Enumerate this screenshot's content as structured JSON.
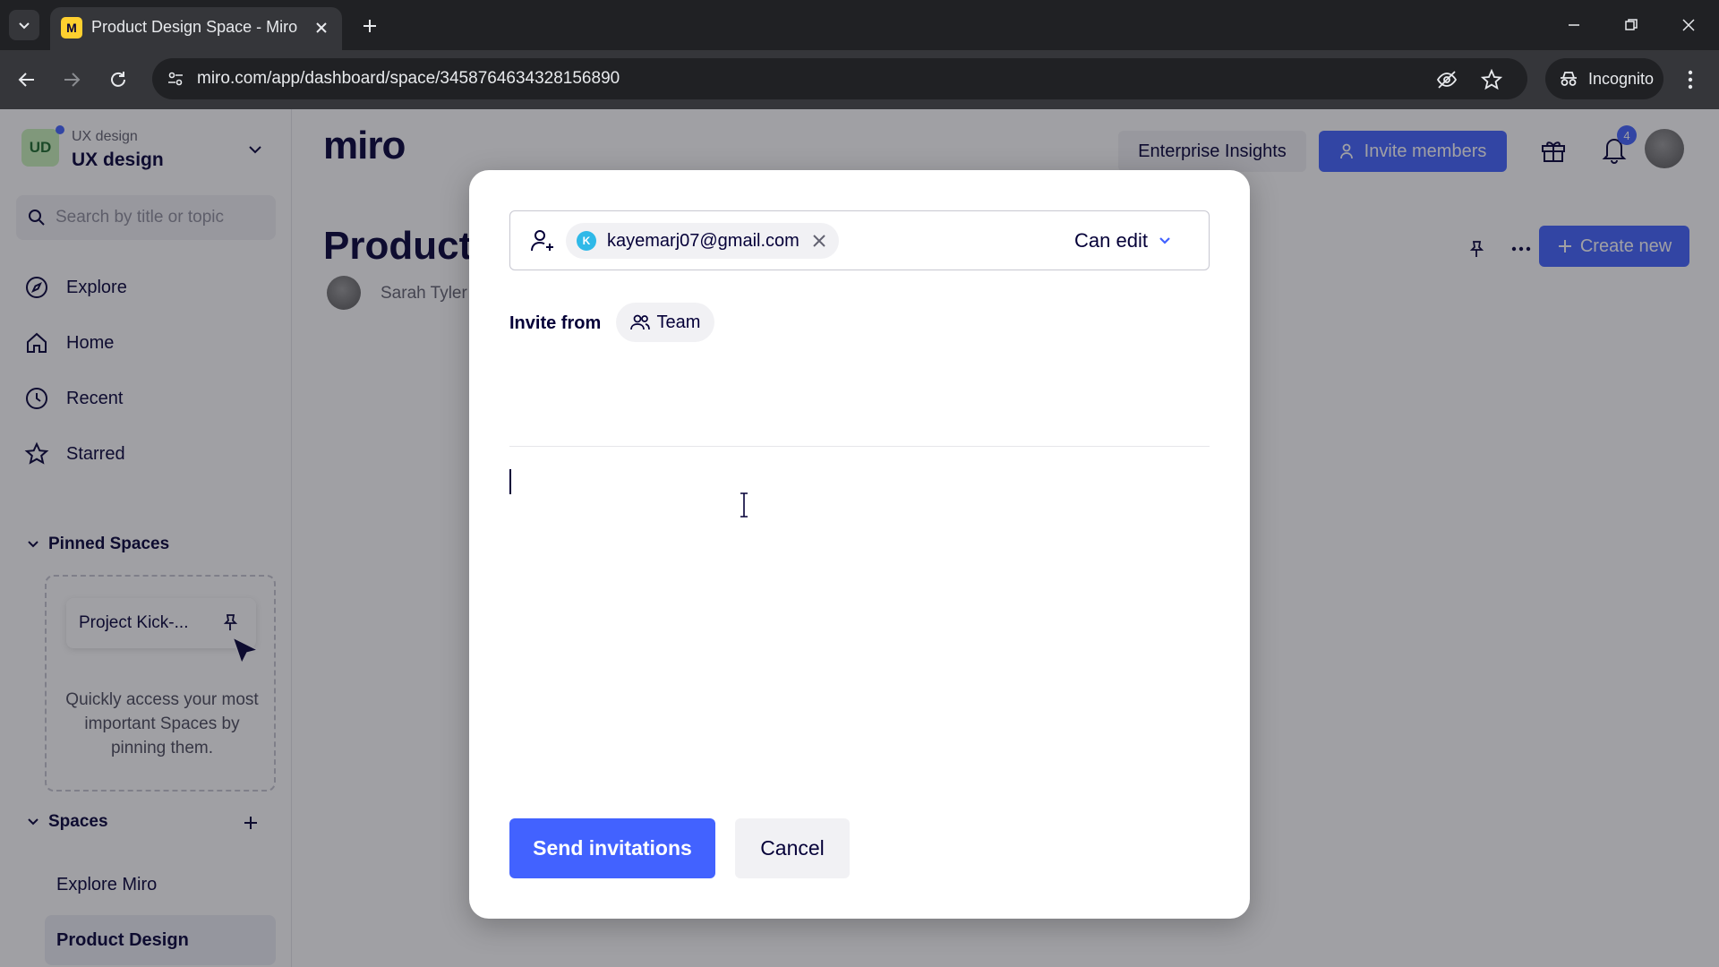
{
  "browser": {
    "tab_title": "Product Design Space - Miro",
    "favicon_letter": "M",
    "url": "miro.com/app/dashboard/space/3458764634328156890",
    "incognito_label": "Incognito"
  },
  "sidebar": {
    "workspace_initials": "UD",
    "workspace_subtitle": "UX design",
    "workspace_name": "UX design",
    "search_placeholder": "Search by title or topic",
    "nav": [
      {
        "label": "Explore",
        "icon": "compass-icon"
      },
      {
        "label": "Home",
        "icon": "home-icon"
      },
      {
        "label": "Recent",
        "icon": "clock-icon"
      },
      {
        "label": "Starred",
        "icon": "star-icon"
      }
    ],
    "pinned_heading": "Pinned Spaces",
    "pinned_card_label": "Project Kick-...",
    "pinned_help": "Quickly access your most important Spaces by pinning them.",
    "spaces_heading": "Spaces",
    "spaces": [
      {
        "label": "Explore Miro",
        "active": false
      },
      {
        "label": "Product Design",
        "active": true
      }
    ]
  },
  "header": {
    "logo": "miro",
    "enterprise_label": "Enterprise Insights",
    "invite_label": "Invite members",
    "notification_count": "4"
  },
  "space": {
    "title": "Product",
    "owner": "Sarah Tyler",
    "create_label": "Create new"
  },
  "modal": {
    "email": "kayemarj07@gmail.com",
    "email_initial": "K",
    "permission": "Can edit",
    "invite_from_label": "Invite from",
    "team_label": "Team",
    "message_value": "",
    "send_label": "Send invitations",
    "cancel_label": "Cancel"
  },
  "colors": {
    "accent": "#4262ff",
    "text": "#050038",
    "chip_avatar": "#2fb9e8",
    "favicon": "#ffd02f"
  }
}
